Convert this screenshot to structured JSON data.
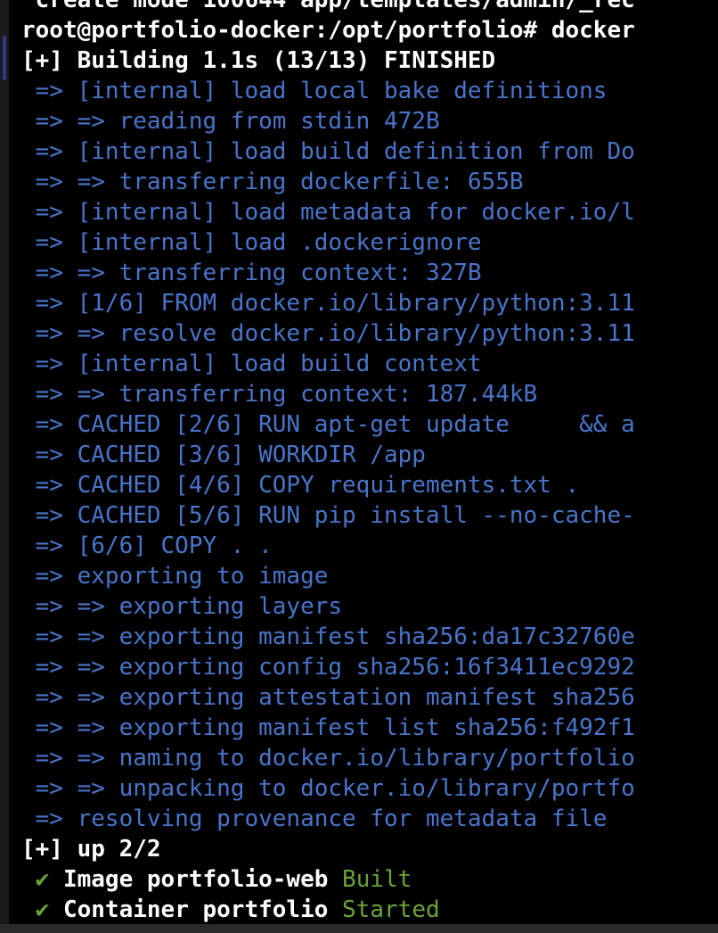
{
  "terminal": {
    "lines": [
      {
        "kind": "top",
        "text": " create mode 100644 app/templates/admin/_rec"
      },
      {
        "kind": "prompt",
        "text": "root@portfolio-docker:/opt/portfolio# docker"
      },
      {
        "kind": "header",
        "text": "[+] Building 1.1s (13/13) FINISHED"
      },
      {
        "kind": "step",
        "text": " => [internal] load local bake definitions"
      },
      {
        "kind": "step",
        "text": " => => reading from stdin 472B"
      },
      {
        "kind": "step",
        "text": " => [internal] load build definition from Do"
      },
      {
        "kind": "step",
        "text": " => => transferring dockerfile: 655B"
      },
      {
        "kind": "step",
        "text": " => [internal] load metadata for docker.io/l"
      },
      {
        "kind": "step",
        "text": " => [internal] load .dockerignore"
      },
      {
        "kind": "step",
        "text": " => => transferring context: 327B"
      },
      {
        "kind": "step",
        "text": " => [1/6] FROM docker.io/library/python:3.11"
      },
      {
        "kind": "step",
        "text": " => => resolve docker.io/library/python:3.11"
      },
      {
        "kind": "step",
        "text": " => [internal] load build context"
      },
      {
        "kind": "step",
        "text": " => => transferring context: 187.44kB"
      },
      {
        "kind": "step",
        "text": " => CACHED [2/6] RUN apt-get update     && a"
      },
      {
        "kind": "step",
        "text": " => CACHED [3/6] WORKDIR /app"
      },
      {
        "kind": "step",
        "text": " => CACHED [4/6] COPY requirements.txt ."
      },
      {
        "kind": "step",
        "text": " => CACHED [5/6] RUN pip install --no-cache-"
      },
      {
        "kind": "step",
        "text": " => [6/6] COPY . ."
      },
      {
        "kind": "step",
        "text": " => exporting to image"
      },
      {
        "kind": "step",
        "text": " => => exporting layers"
      },
      {
        "kind": "step",
        "text": " => => exporting manifest sha256:da17c32760e"
      },
      {
        "kind": "step",
        "text": " => => exporting config sha256:16f3411ec9292"
      },
      {
        "kind": "step",
        "text": " => => exporting attestation manifest sha256"
      },
      {
        "kind": "step",
        "text": " => => exporting manifest list sha256:f492f1"
      },
      {
        "kind": "step",
        "text": " => => naming to docker.io/library/portfolio"
      },
      {
        "kind": "step",
        "text": " => => unpacking to docker.io/library/portfo"
      },
      {
        "kind": "step",
        "text": " => resolving provenance for metadata file"
      },
      {
        "kind": "header",
        "text": "[+] up 2/2"
      },
      {
        "kind": "status",
        "check": " ✔ ",
        "label": "Image portfolio-web ",
        "state": "Built"
      },
      {
        "kind": "status",
        "check": " ✔ ",
        "label": "Container portfolio ",
        "state": "Started"
      }
    ]
  },
  "colors": {
    "background": "#000000",
    "text": "#ffffff",
    "step": "#4a74c9",
    "success": "#6aa33a"
  }
}
